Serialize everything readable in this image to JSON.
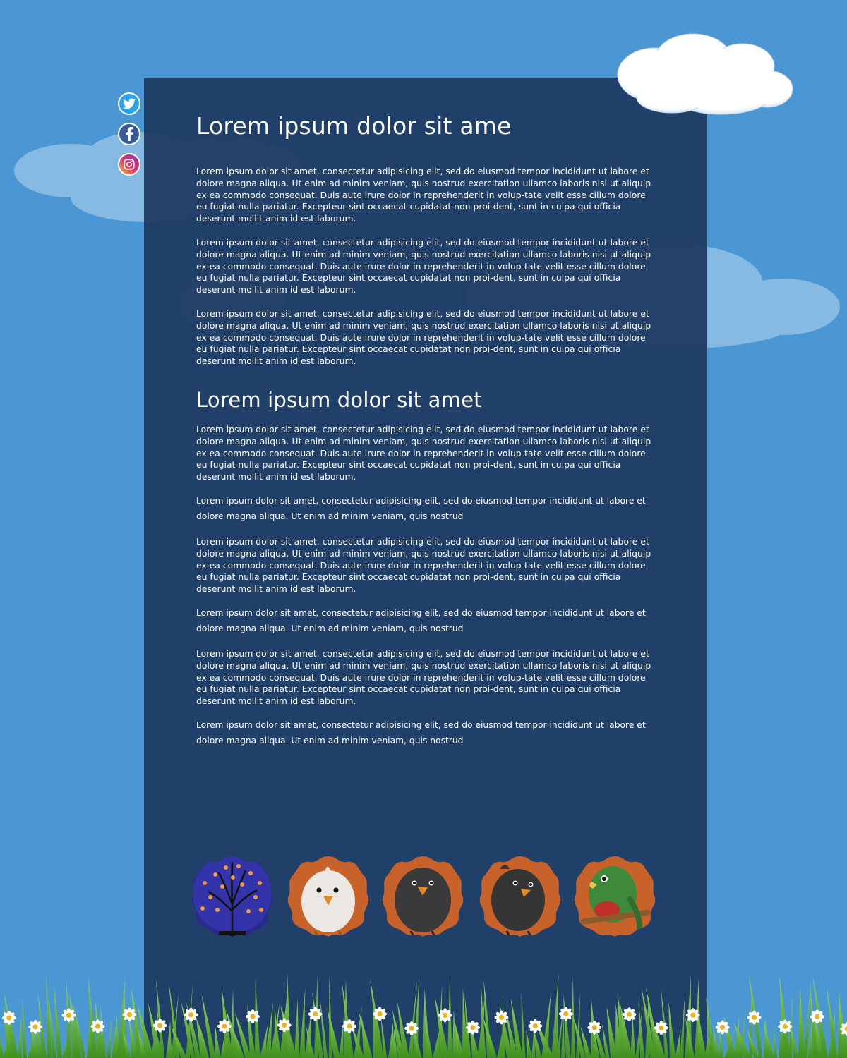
{
  "social": {
    "twitter_icon": "twitter-icon",
    "facebook_icon": "facebook-icon",
    "instagram_icon": "instagram-icon"
  },
  "article": {
    "title": "Lorem ipsum dolor sit ame",
    "intro_paragraphs": [
      "Lorem ipsum dolor sit amet, consectetur adipisicing elit, sed do eiusmod tempor incididunt ut labore et dolore magna aliqua. Ut enim ad minim veniam, quis nostrud exercitation ullamco laboris nisi ut aliquip ex ea commodo consequat. Duis aute irure dolor in reprehenderit in volup-tate velit esse cillum dolore eu fugiat nulla pariatur. Excepteur sint occaecat cupidatat non proi-dent, sunt in culpa qui officia deserunt mollit anim id est laborum.",
      "Lorem ipsum dolor sit amet, consectetur adipisicing elit, sed do eiusmod tempor incididunt ut labore et dolore magna aliqua. Ut enim ad minim veniam, quis nostrud exercitation ullamco laboris nisi ut aliquip ex ea commodo consequat. Duis aute irure dolor in reprehenderit in volup-tate velit esse cillum dolore eu fugiat nulla pariatur. Excepteur sint occaecat cupidatat non proi-dent, sunt in culpa qui officia deserunt mollit anim id est laborum.",
      "Lorem ipsum dolor sit amet, consectetur adipisicing elit, sed do eiusmod tempor incididunt ut labore et dolore magna aliqua. Ut enim ad minim veniam, quis nostrud exercitation ullamco laboris nisi ut aliquip ex ea commodo consequat. Duis aute irure dolor in reprehenderit in volup-tate velit esse cillum dolore eu fugiat nulla pariatur. Excepteur sint occaecat cupidatat non proi-dent, sunt in culpa qui officia deserunt mollit anim id est laborum."
    ],
    "subtitle": "Lorem ipsum dolor sit amet",
    "sections": [
      {
        "long": "Lorem ipsum dolor sit amet, consectetur adipisicing elit, sed do eiusmod tempor incididunt ut labore et dolore magna aliqua. Ut enim ad minim veniam, quis nostrud exercitation ullamco laboris nisi ut aliquip ex ea commodo consequat. Duis aute irure dolor in reprehenderit in volup-tate velit esse cillum dolore eu fugiat nulla pariatur. Excepteur sint occaecat cupidatat non proi-dent, sunt in culpa qui officia deserunt mollit anim id est laborum.",
        "short": "Lorem ipsum dolor sit amet, consectetur adipisicing elit, sed do eiusmod tempor incididunt ut labore et dolore magna aliqua. Ut enim ad minim veniam, quis nostrud"
      },
      {
        "long": "Lorem ipsum dolor sit amet, consectetur adipisicing elit, sed do eiusmod tempor incididunt ut labore et dolore magna aliqua. Ut enim ad minim veniam, quis nostrud exercitation ullamco laboris nisi ut aliquip ex ea commodo consequat. Duis aute irure dolor in reprehenderit in volup-tate velit esse cillum dolore eu fugiat nulla pariatur. Excepteur sint occaecat cupidatat non proi-dent, sunt in culpa qui officia deserunt mollit anim id est laborum.",
        "short": "Lorem ipsum dolor sit amet, consectetur adipisicing elit, sed do eiusmod tempor incididunt ut labore et dolore magna aliqua. Ut enim ad minim veniam, quis nostrud"
      },
      {
        "long": "Lorem ipsum dolor sit amet, consectetur adipisicing elit, sed do eiusmod tempor incididunt ut labore et dolore magna aliqua. Ut enim ad minim veniam, quis nostrud exercitation ullamco laboris nisi ut aliquip ex ea commodo consequat. Duis aute irure dolor in reprehenderit in volup-tate velit esse cillum dolore eu fugiat nulla pariatur. Excepteur sint occaecat cupidatat non proi-dent, sunt in culpa qui officia deserunt mollit anim id est laborum.",
        "short": "Lorem ipsum dolor sit amet, consectetur adipisicing elit, sed do eiusmod tempor incididunt ut labore et dolore magna aliqua. Ut enim ad minim veniam, quis nostrud"
      }
    ]
  },
  "gallery": {
    "items": [
      "tree-avatar",
      "white-chick-avatar",
      "black-chick-avatar",
      "black-bird-avatar",
      "green-parrot-avatar"
    ]
  },
  "colors": {
    "sky": "#4a97d3",
    "panel": "#203d65",
    "text": "#ffffff",
    "avatar_bg": "#c8622b"
  }
}
